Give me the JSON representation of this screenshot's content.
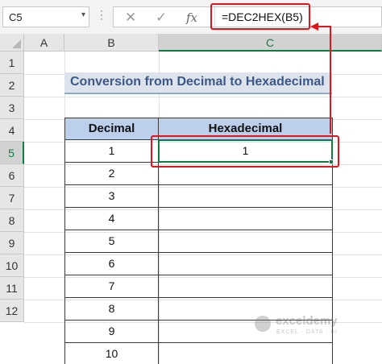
{
  "formula_bar": {
    "name_box": "C5",
    "name_box_arrow": "▾",
    "cancel_icon": "✕",
    "enter_icon": "✓",
    "fx_label": "fx",
    "formula": "=DEC2HEX(B5)"
  },
  "columns": [
    "A",
    "B",
    "C"
  ],
  "rows": [
    "1",
    "2",
    "3",
    "4",
    "5",
    "6",
    "7",
    "8",
    "9",
    "10",
    "11",
    "12"
  ],
  "selected_cell": "C5",
  "title": "Conversion from Decimal to Hexadecimal",
  "table": {
    "headers": [
      "Decimal",
      "Hexadecimal"
    ],
    "decimal": [
      "1",
      "2",
      "3",
      "4",
      "5",
      "6",
      "7",
      "8",
      "9",
      "10"
    ],
    "hexadecimal": [
      "1",
      "",
      "",
      "",
      "",
      "",
      "",
      "",
      "",
      ""
    ]
  },
  "watermark": {
    "name": "exceldemy",
    "tagline": "EXCEL · DATA · BI"
  },
  "colors": {
    "highlight": "#e0161c",
    "selection": "#107c41",
    "header_fill": "#bcd0ec",
    "title_fill": "#dde3ec",
    "title_text": "#3b5886"
  }
}
